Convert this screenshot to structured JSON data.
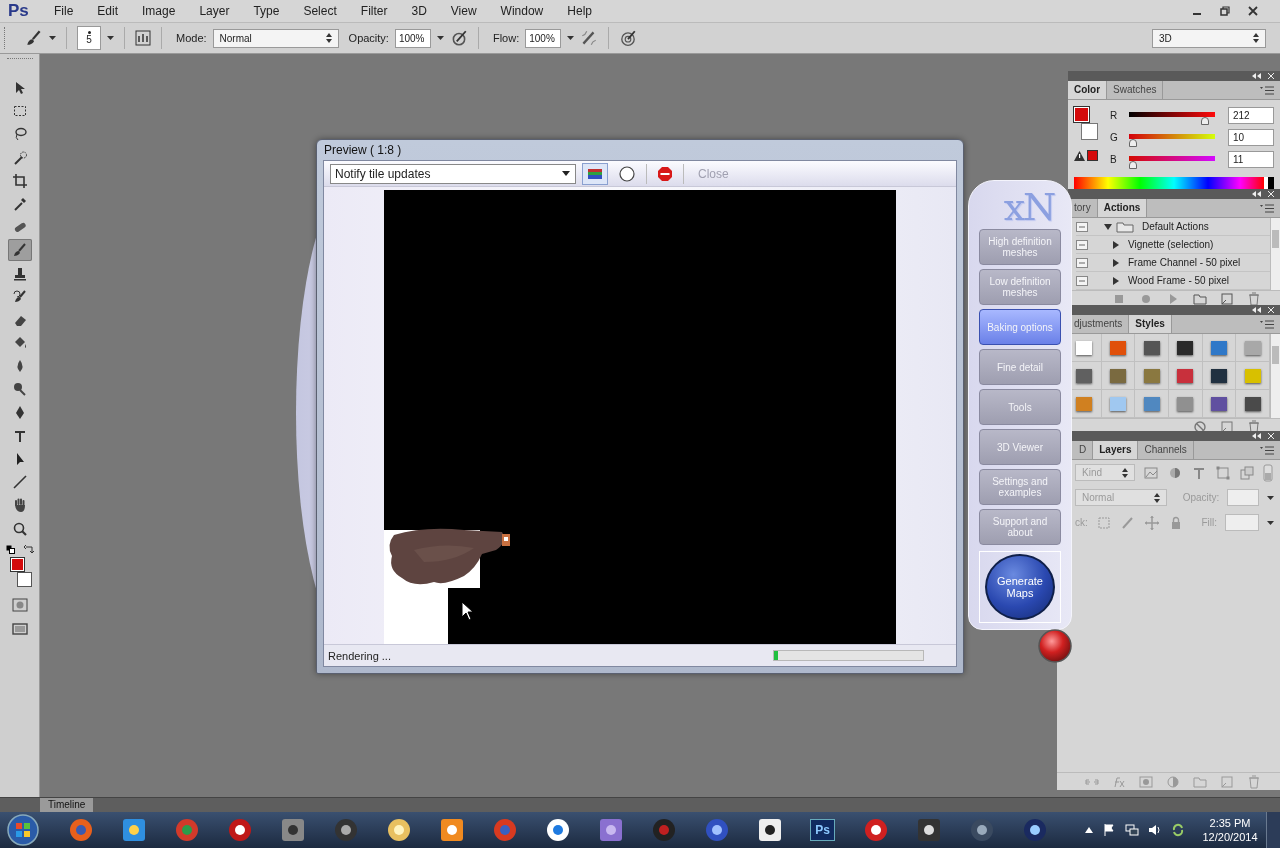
{
  "app": {
    "logo": "Ps"
  },
  "menu": [
    "File",
    "Edit",
    "Image",
    "Layer",
    "Type",
    "Select",
    "Filter",
    "3D",
    "View",
    "Window",
    "Help"
  ],
  "options_bar": {
    "brush_size": "5",
    "mode_label": "Mode:",
    "mode": "Normal",
    "opacity_label": "Opacity:",
    "opacity": "100%",
    "flow_label": "Flow:",
    "flow": "100%",
    "workspace": "3D"
  },
  "tools": [
    {
      "kind": "arrow",
      "selected": false
    },
    {
      "kind": "marquee",
      "selected": false
    },
    {
      "kind": "lasso",
      "selected": false
    },
    {
      "kind": "wand",
      "selected": false
    },
    {
      "kind": "crop",
      "selected": false
    },
    {
      "kind": "eyedropper",
      "selected": false
    },
    {
      "kind": "bandage",
      "selected": false
    },
    {
      "kind": "brush",
      "selected": true
    },
    {
      "kind": "stamp",
      "selected": false
    },
    {
      "kind": "history-brush",
      "selected": false
    },
    {
      "kind": "eraser",
      "selected": false
    },
    {
      "kind": "bucket",
      "selected": false
    },
    {
      "kind": "drop",
      "selected": false
    },
    {
      "kind": "dodge",
      "selected": false
    },
    {
      "kind": "pen",
      "selected": false
    },
    {
      "kind": "type",
      "selected": false
    },
    {
      "kind": "pointer",
      "selected": false
    },
    {
      "kind": "line",
      "selected": false
    },
    {
      "kind": "hand",
      "selected": false
    },
    {
      "kind": "magnifier",
      "selected": false
    }
  ],
  "color_swatches": [
    {
      "kind": "foreground",
      "color": "#d40a0b"
    },
    {
      "kind": "background",
      "color": "#ffffff"
    }
  ],
  "preview": {
    "title": "Preview ( 1:8 )",
    "notify": "Notify tile updates",
    "close": "Close",
    "close_disabled": true,
    "status": "Rendering ...",
    "level": 0.03
  },
  "xnormal": {
    "logo": "xN",
    "buttons": [
      {
        "label": "High definition meshes",
        "selected": false
      },
      {
        "label": "Low definition meshes",
        "selected": false
      },
      {
        "label": "Baking options",
        "selected": true
      },
      {
        "label": "Fine detail",
        "selected": false
      },
      {
        "label": "Tools",
        "selected": false
      },
      {
        "label": "3D Viewer",
        "selected": false
      },
      {
        "label": "Settings and examples",
        "selected": false
      },
      {
        "label": "Support and about",
        "selected": false
      }
    ],
    "generate": "Generate Maps"
  },
  "color_panel": {
    "tabs": [
      {
        "label": "Color",
        "selected": true
      },
      {
        "label": "Swatches",
        "selected": false
      }
    ],
    "channels": [
      {
        "name": "R",
        "value": "212",
        "level": 0.83
      },
      {
        "name": "G",
        "value": "10",
        "level": 0.04
      },
      {
        "name": "B",
        "value": "11",
        "level": 0.04
      }
    ]
  },
  "actions_panel": {
    "tabs": [
      {
        "label": "tory",
        "selected": false
      },
      {
        "label": "Actions",
        "selected": true
      }
    ],
    "items": [
      {
        "label": "Default Actions",
        "expanded": true,
        "children": [
          {
            "label": "Vignette (selection)",
            "expanded": false
          },
          {
            "label": "Frame Channel - 50 pixel",
            "expanded": false
          },
          {
            "label": "Wood Frame - 50 pixel",
            "expanded": false
          }
        ]
      }
    ]
  },
  "styles_panel": {
    "tabs": [
      {
        "label": "djustments",
        "selected": false
      },
      {
        "label": "Styles",
        "selected": true
      }
    ],
    "swatches": [
      {
        "color": "#ffffff"
      },
      {
        "color": "#e0500a"
      },
      {
        "color": "#555555"
      },
      {
        "color": "#2a2a2a"
      },
      {
        "color": "#2f78c8"
      },
      {
        "color": "#a8a8a8"
      },
      {
        "color": "#606060"
      },
      {
        "color": "#7a6a40"
      },
      {
        "color": "#8a7840"
      },
      {
        "color": "#c8303c"
      },
      {
        "color": "#203040"
      },
      {
        "color": "#d8c000"
      },
      {
        "color": "#d08020"
      },
      {
        "color": "#a0c8f0"
      },
      {
        "color": "#5088c0"
      },
      {
        "color": "#909090"
      },
      {
        "color": "#6050a0"
      },
      {
        "color": "#4a4a4a"
      }
    ]
  },
  "layers_panel": {
    "tabs": [
      {
        "label": "D",
        "selected": false
      },
      {
        "label": "Layers",
        "selected": true
      },
      {
        "label": "Channels",
        "selected": false
      }
    ],
    "filter": "Kind",
    "blend_mode": "Normal",
    "opacity_label": "Opacity:",
    "lock_label": "ck:",
    "fill_label": "Fill:",
    "disabled": true
  },
  "timeline": {
    "label": "Timeline"
  },
  "taskbar": {
    "apps": [
      {
        "kind": "fox"
      },
      {
        "kind": "e"
      },
      {
        "kind": "chrome"
      },
      {
        "kind": "fz"
      },
      {
        "kind": "ring"
      },
      {
        "kind": "eye"
      },
      {
        "kind": "folder"
      },
      {
        "kind": "play"
      },
      {
        "kind": "sweep"
      },
      {
        "kind": "box"
      },
      {
        "kind": "purple"
      },
      {
        "kind": "ball"
      },
      {
        "kind": "csquare"
      },
      {
        "kind": "runner"
      },
      {
        "kind": "ps",
        "label": "Ps"
      },
      {
        "kind": "s"
      },
      {
        "kind": "swirl"
      },
      {
        "kind": "ccircle"
      },
      {
        "kind": "aperture"
      }
    ],
    "time": "2:35 PM",
    "date": "12/20/2014"
  }
}
